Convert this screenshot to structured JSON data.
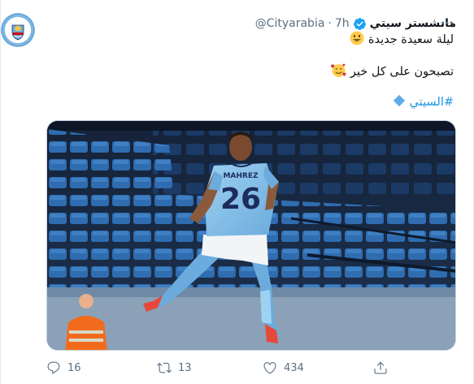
{
  "account": {
    "display_name": "مانشستر سيتي",
    "handle": "@Cityarabia",
    "separator": "·",
    "time": "7h",
    "verified": true,
    "avatar_badge_text": "MANCHESTER CITY"
  },
  "tweet": {
    "line1_text": "ليلة سعيدة جديدة",
    "line1_emoji": "grinning-face",
    "line2_text": "تصبحون على كل خير",
    "line2_emoji": "smiling-face-with-hearts",
    "hashtag": "#السيتي",
    "hashtag_icon": "blue-diamond",
    "media": {
      "jersey_name": "MAHREZ",
      "jersey_number": "26"
    }
  },
  "actions": {
    "reply_count": "16",
    "retweet_count": "13",
    "like_count": "434"
  },
  "colors": {
    "brand_blue": "#1b95e0",
    "muted": "#5b7083",
    "city_sky_blue": "#6cabdd"
  }
}
